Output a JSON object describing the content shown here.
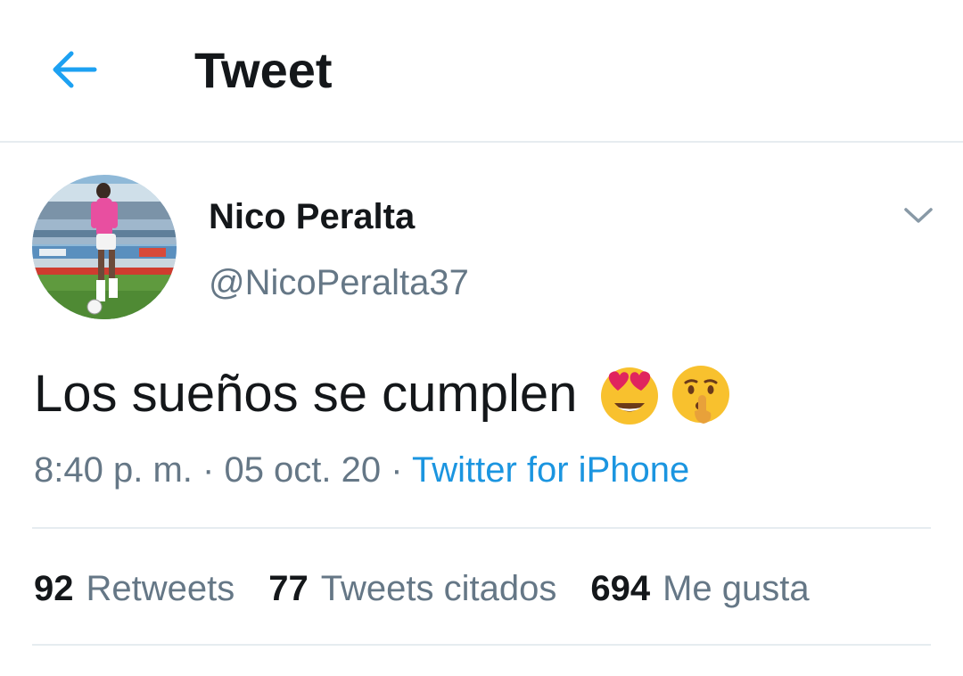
{
  "header": {
    "title": "Tweet",
    "back_icon": "arrow-left-icon",
    "accent": "#1da1f2"
  },
  "author": {
    "name": "Nico Peralta",
    "handle": "@NicoPeralta37",
    "avatar": "player-photo",
    "menu_icon": "chevron-down-icon"
  },
  "tweet": {
    "text": "Los sueños se cumplen",
    "emojis": [
      "heart-eyes-emoji",
      "shushing-face-emoji"
    ],
    "time": "8:40 p. m.",
    "separator": "·",
    "date": "05 oct. 20",
    "source": "Twitter for iPhone"
  },
  "stats": {
    "retweets_count": "92",
    "retweets_label": "Retweets",
    "quotes_count": "77",
    "quotes_label": "Tweets citados",
    "likes_count": "694",
    "likes_label": "Me gusta"
  },
  "colors": {
    "text_primary": "#14171a",
    "text_secondary": "#657786",
    "link": "#1b95e0",
    "divider": "#e6ecf0"
  }
}
